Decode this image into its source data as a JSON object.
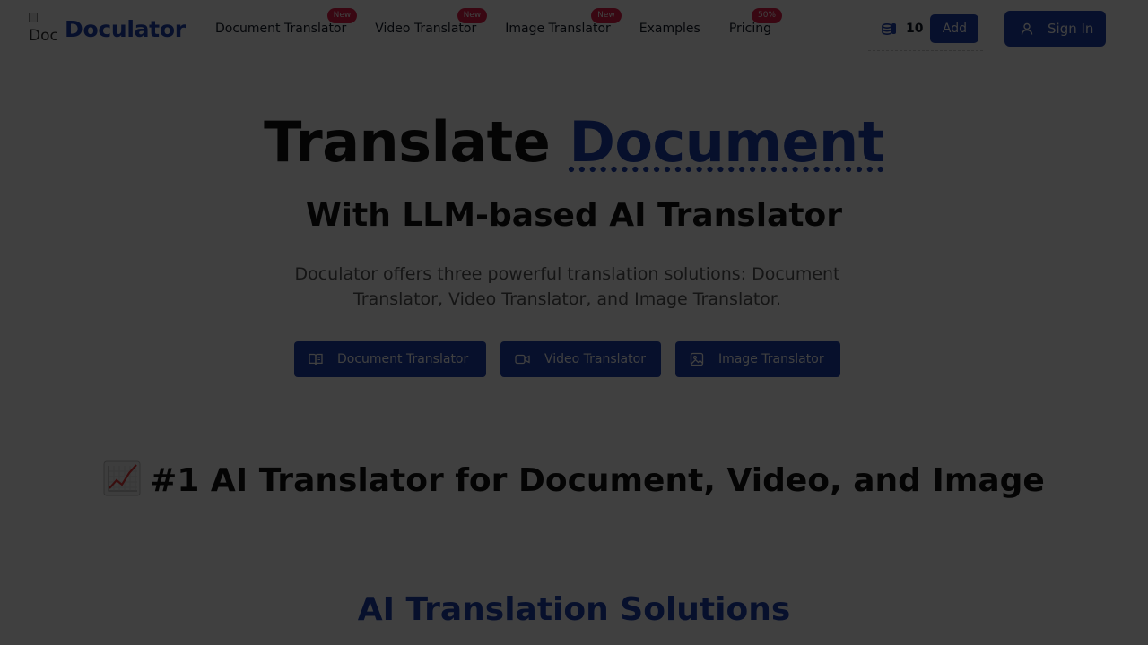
{
  "brand": {
    "logo_alt": "Doc",
    "name": "Doculator",
    "color": "#1e40af"
  },
  "nav": {
    "links": [
      {
        "label": "Document Translator",
        "badge": "New"
      },
      {
        "label": "Video Translator",
        "badge": "New"
      },
      {
        "label": "Image Translator",
        "badge": "New"
      },
      {
        "label": "Examples",
        "badge": ""
      },
      {
        "label": "Pricing",
        "badge": "50%"
      }
    ],
    "credits": "10",
    "add_label": "Add",
    "signin_label": "Sign In"
  },
  "hero": {
    "title_plain": "Translate",
    "title_accent": "Document",
    "subtitle": "With LLM-based AI Translator",
    "description": "Doculator offers three powerful translation solutions: Document Translator, Video Translator, and Image Translator.",
    "ctas": {
      "document": "Document Translator",
      "video": "Video Translator",
      "image": "Image Translator"
    }
  },
  "sections": {
    "rank_title": "#1 AI Translator for Document, Video, and Image",
    "solutions_title": "AI Translation Solutions"
  },
  "colors": {
    "accent": "#1e40af",
    "badge": "#e11d48",
    "overlay": "rgba(0,0,0,0.75)"
  },
  "icons": {
    "logo": "broken-image-icon",
    "credits": "coins-icon",
    "signin": "user-icon",
    "document": "book-icon",
    "video": "video-camera-icon",
    "image": "image-icon",
    "chart": "chart-increasing-emoji"
  }
}
